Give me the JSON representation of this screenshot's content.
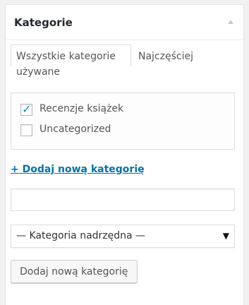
{
  "box": {
    "title": "Kategorie"
  },
  "tabs": {
    "all_label": "Wszystkie kategorie",
    "popular_line1": "Najczęściej",
    "popular_line2": "używane"
  },
  "categories": [
    {
      "label": "Recenzje książek",
      "checked": true
    },
    {
      "label": "Uncategorized",
      "checked": false
    }
  ],
  "add_toggle_label": "+ Dodaj nową kategorię",
  "new_category": {
    "value": "",
    "placeholder": ""
  },
  "parent_select": {
    "selected": "— Kategoria nadrzędna —",
    "caret": "▼"
  },
  "submit_label": "Dodaj nową kategorię",
  "icons": {
    "checkmark": "✓"
  },
  "colors": {
    "link": "#0073aa",
    "check": "#1e8cbe"
  }
}
